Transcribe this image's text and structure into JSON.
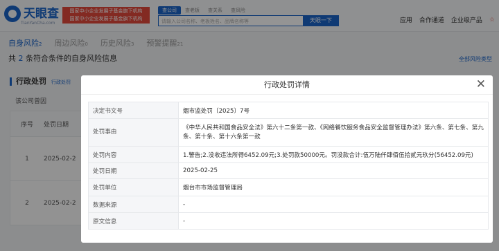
{
  "header": {
    "logo_text": "天眼查",
    "logo_sub": "TianYanCha.com",
    "promo_line1": "国家中小企业发展子基金旗下机构",
    "promo_line2": "国家中小企业发展子基金旗下机构",
    "search_tabs": [
      "查公司",
      "查老板",
      "查关系",
      "查风险"
    ],
    "search_placeholder": "请输入公司名称、老板姓名、品牌名称等",
    "search_button": "天眼一下",
    "nav": [
      "应用",
      "合作通道",
      "企业级产品"
    ],
    "fav": "☆"
  },
  "subtabs": [
    {
      "label": "自身风险",
      "count": "2"
    },
    {
      "label": "周边风险",
      "count": "0"
    },
    {
      "label": "历史风险",
      "count": "3"
    },
    {
      "label": "预警提醒",
      "count": "21"
    }
  ],
  "count_line": {
    "prefix": "共",
    "num": "2",
    "suffix": "条符合条件的自身风险信息"
  },
  "all_types": "全部风险类型",
  "section": {
    "title": "行政处罚",
    "hint": "行政处罚",
    "desc": "该公司曾因",
    "headers": [
      "序号",
      "处罚日期"
    ],
    "rows": [
      {
        "no": "1",
        "date": "2025-02-2"
      },
      {
        "no": "2",
        "date": "2025-02-2"
      }
    ]
  },
  "modal": {
    "title": "行政处罚详情",
    "close": "✕",
    "rows": [
      {
        "key": "决定书文号",
        "value": "烟市监处罚〔2025〕7号"
      },
      {
        "key": "处罚事由",
        "value": "《中华人民共和国食品安全法》第六十二条第一款、《网络餐饮服务食品安全监督管理办法》第六条、第七条、第九条、第十条、第十六条第一款"
      },
      {
        "key": "处罚内容",
        "value": "1.警告;2.没收违法所得6452.09元;3.处罚款50000元。罚没款合计:伍万陆仟肆佰伍拾贰元玖分(56452.09元)"
      },
      {
        "key": "处罚日期",
        "value": "2025-02-25"
      },
      {
        "key": "处罚单位",
        "value": "烟台市市场监督管理局"
      },
      {
        "key": "数据来源",
        "value": "-"
      },
      {
        "key": "原文信息",
        "value": "-"
      }
    ]
  }
}
